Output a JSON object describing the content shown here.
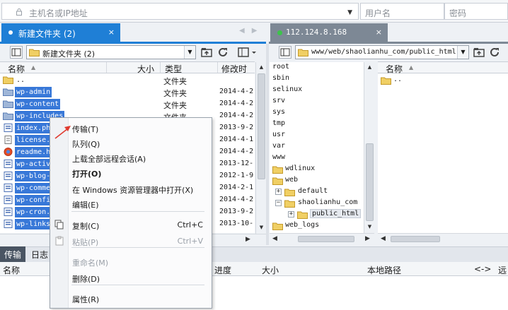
{
  "connection": {
    "host_placeholder": "主机名或IP地址",
    "user_placeholder": "用户名",
    "password_placeholder": "密码"
  },
  "tabs": {
    "local_tab": "新建文件夹 (2)",
    "remote_tab": "112.124.8.168",
    "close": "×"
  },
  "local": {
    "path": "新建文件夹 (2)",
    "columns": {
      "name": "名称",
      "size": "大小",
      "type": "类型",
      "modified": "修改时间"
    },
    "files": [
      {
        "name": "..",
        "type": "文件夹",
        "date": ""
      },
      {
        "name": "wp-admin",
        "type": "文件夹",
        "date": "2014-4-2"
      },
      {
        "name": "wp-content",
        "type": "文件夹",
        "date": "2014-4-2"
      },
      {
        "name": "wp-includes",
        "type": "文件夹",
        "date": "2014-4-2"
      },
      {
        "name": "index.php",
        "type": "",
        "date": "2013-9-2"
      },
      {
        "name": "license.txt",
        "type": "",
        "date": "2014-4-1"
      },
      {
        "name": "readme.html",
        "type": "",
        "date": "2014-4-2"
      },
      {
        "name": "wp-activate.php",
        "type": "",
        "date": "2013-12-"
      },
      {
        "name": "wp-blog-header.php",
        "type": "",
        "date": "2012-1-9"
      },
      {
        "name": "wp-comments-post.php",
        "type": "",
        "date": "2014-2-1"
      },
      {
        "name": "wp-config-sample.php",
        "type": "",
        "date": "2014-4-2"
      },
      {
        "name": "wp-cron.php",
        "type": "",
        "date": "2013-9-2"
      },
      {
        "name": "wp-links-opml.php",
        "type": "",
        "date": "2013-10-"
      }
    ],
    "visible_names": [
      "..",
      "wp-admin",
      "wp-content",
      "wp-includes",
      "index.ph",
      "license.",
      "readme.h",
      "wp-activ",
      "wp-blog-",
      "wp-comme",
      "wp-confi",
      "wp-cron.",
      "wp-links"
    ]
  },
  "remote": {
    "path": "www/web/shaolianhu_com/public_html",
    "tree": [
      {
        "label": "root",
        "level": 0,
        "folder": false
      },
      {
        "label": "sbin",
        "level": 0,
        "folder": false
      },
      {
        "label": "selinux",
        "level": 0,
        "folder": false
      },
      {
        "label": "srv",
        "level": 0,
        "folder": false
      },
      {
        "label": "sys",
        "level": 0,
        "folder": false
      },
      {
        "label": "tmp",
        "level": 0,
        "folder": false
      },
      {
        "label": "usr",
        "level": 0,
        "folder": false
      },
      {
        "label": "var",
        "level": 0,
        "folder": false
      },
      {
        "label": "www",
        "level": 0,
        "folder": false
      },
      {
        "label": "wdlinux",
        "level": 0,
        "folder": true
      },
      {
        "label": "web",
        "level": 0,
        "folder": true
      },
      {
        "label": "default",
        "level": 1,
        "folder": true
      },
      {
        "label": "shaolianhu_com",
        "level": 1,
        "folder": true
      },
      {
        "label": "public_html",
        "level": 2,
        "folder": true
      },
      {
        "label": "web_logs",
        "level": 0,
        "folder": true
      }
    ],
    "list_header": "名称",
    "list": [
      ".."
    ]
  },
  "context_menu": {
    "items": [
      {
        "label": "传输(T)",
        "shortcut": "",
        "disabled": false,
        "bold": false
      },
      {
        "label": "队列(Q)",
        "shortcut": "",
        "disabled": false,
        "bold": false
      },
      {
        "label": "上载全部远程会话(A)",
        "shortcut": "",
        "disabled": false,
        "bold": false
      },
      {
        "label": "打开(O)",
        "shortcut": "",
        "disabled": false,
        "bold": true
      },
      {
        "label": "在 Windows 资源管理器中打开(X)",
        "shortcut": "",
        "disabled": false,
        "bold": false
      },
      {
        "label": "编辑(E)",
        "shortcut": "",
        "disabled": false,
        "bold": false
      },
      {
        "label": "复制(C)",
        "shortcut": "Ctrl+C",
        "disabled": false,
        "bold": false
      },
      {
        "label": "粘贴(P)",
        "shortcut": "Ctrl+V",
        "disabled": true,
        "bold": false
      },
      {
        "label": "重命名(M)",
        "shortcut": "",
        "disabled": true,
        "bold": false
      },
      {
        "label": "删除(D)",
        "shortcut": "",
        "disabled": false,
        "bold": false
      },
      {
        "label": "属性(R)",
        "shortcut": "",
        "disabled": false,
        "bold": false
      }
    ]
  },
  "bottom": {
    "tab_transfer": "传输",
    "tab_log": "日志",
    "columns": {
      "name": "名称",
      "progress": "进度",
      "size": "大小",
      "local_path": "本地路径",
      "direction": "<->",
      "remote": "远"
    }
  },
  "colors": {
    "accent": "#1f7fd6",
    "selection": "#3878d8",
    "folder": "#e8c04a"
  }
}
